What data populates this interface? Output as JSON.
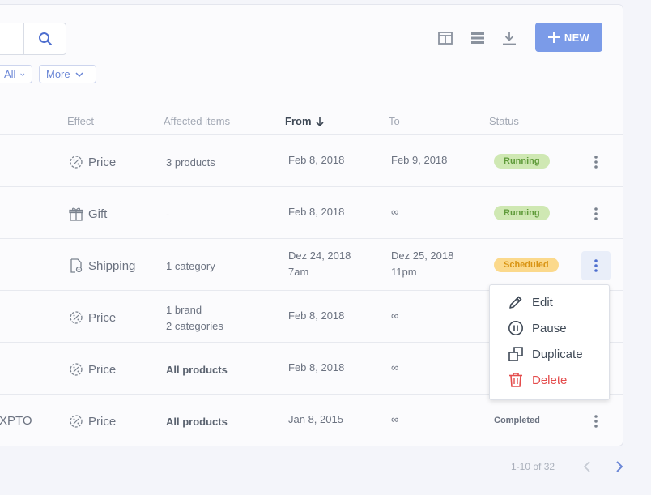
{
  "filters": {
    "all_label": "All",
    "more_label": "More"
  },
  "toolbar": {
    "new_label": "NEW"
  },
  "columns": {
    "effect": "Effect",
    "affected": "Affected items",
    "from": "From",
    "to": "To",
    "status": "Status"
  },
  "rows": [
    {
      "name": "",
      "effect": "Price",
      "effect_icon": "gear-percent-icon",
      "affected": [
        "3 products"
      ],
      "affected_bold": false,
      "from": [
        "Feb 8, 2018"
      ],
      "to": [
        "Feb 9, 2018"
      ],
      "status": "Running"
    },
    {
      "name": "",
      "effect": "Gift",
      "effect_icon": "gift-icon",
      "affected": [
        "-"
      ],
      "affected_bold": false,
      "from": [
        "Feb 8, 2018"
      ],
      "to": [
        "∞"
      ],
      "status": "Running"
    },
    {
      "name": "",
      "effect": "Shipping",
      "effect_icon": "shipping-doc-icon",
      "affected": [
        "1 category"
      ],
      "affected_bold": false,
      "from": [
        "Dez 24, 2018",
        "7am"
      ],
      "to": [
        "Dez 25, 2018",
        "11pm"
      ],
      "status": "Scheduled"
    },
    {
      "name": "",
      "effect": "Price",
      "effect_icon": "gear-percent-icon",
      "affected": [
        "1 brand",
        "2 categories"
      ],
      "affected_bold": false,
      "from": [
        "Feb 8, 2018"
      ],
      "to": [
        "∞"
      ],
      "status": ""
    },
    {
      "name": "",
      "effect": "Price",
      "effect_icon": "gear-percent-icon",
      "affected": [
        "All products"
      ],
      "affected_bold": true,
      "from": [
        "Feb 8, 2018"
      ],
      "to": [
        "∞"
      ],
      "status": ""
    },
    {
      "name": "XPTO",
      "effect": "Price",
      "effect_icon": "gear-percent-icon",
      "affected": [
        "All products"
      ],
      "affected_bold": true,
      "from": [
        "Jan 8, 2015"
      ],
      "to": [
        "∞"
      ],
      "status": "Completed"
    }
  ],
  "menu": {
    "edit": "Edit",
    "pause": "Pause",
    "duplicate": "Duplicate",
    "delete": "Delete"
  },
  "pagination": {
    "label": "1-10 of 32"
  },
  "colors": {
    "accent": "#7b9be8",
    "running": "#cfe8b3",
    "scheduled": "#fbd98c",
    "danger": "#e44c4c"
  }
}
